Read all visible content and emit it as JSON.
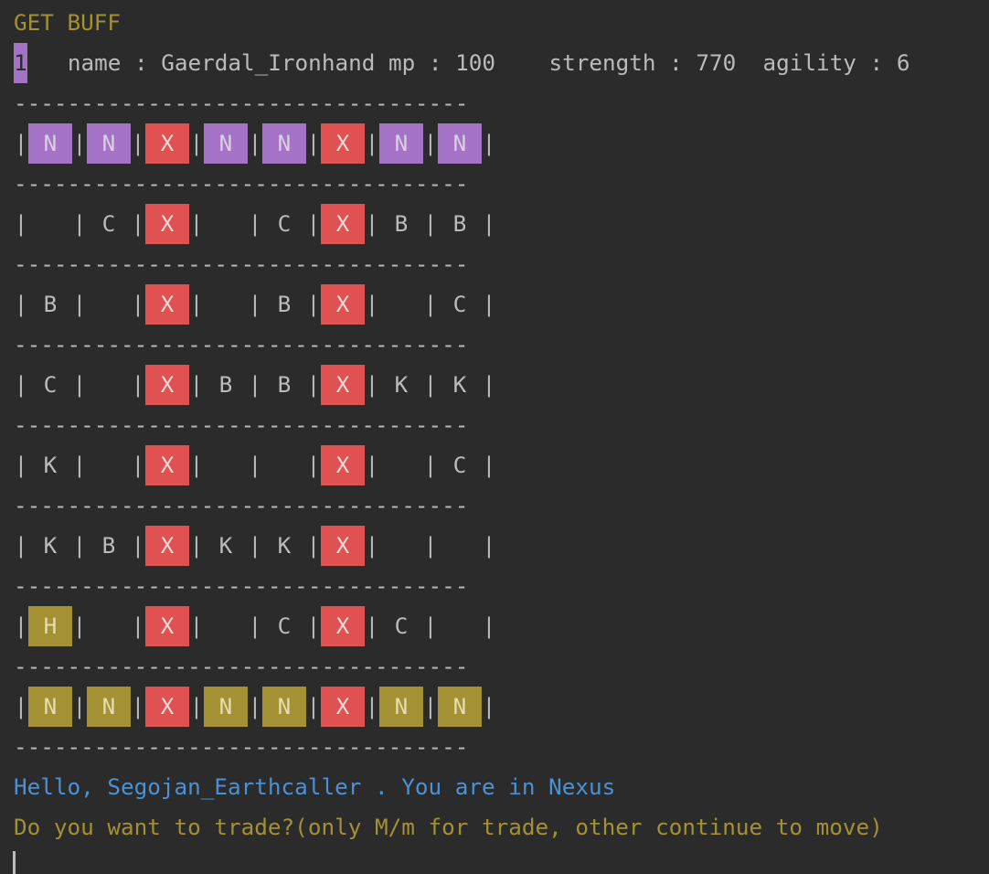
{
  "header": {
    "status": "GET BUFF",
    "index": "1",
    "info": "   name : Gaerdal_Ironhand mp : 100    strength : 770  agility : 6"
  },
  "separator": "----------------------------------",
  "board": {
    "rows": [
      [
        {
          "t": "N",
          "c": "purple"
        },
        {
          "t": "N",
          "c": "purple"
        },
        {
          "t": "X",
          "c": "red"
        },
        {
          "t": "N",
          "c": "purple"
        },
        {
          "t": "N",
          "c": "purple"
        },
        {
          "t": "X",
          "c": "red"
        },
        {
          "t": "N",
          "c": "purple"
        },
        {
          "t": "N",
          "c": "purple"
        }
      ],
      [
        {
          "t": "",
          "c": ""
        },
        {
          "t": "C",
          "c": ""
        },
        {
          "t": "X",
          "c": "red"
        },
        {
          "t": "",
          "c": ""
        },
        {
          "t": "C",
          "c": ""
        },
        {
          "t": "X",
          "c": "red"
        },
        {
          "t": "B",
          "c": ""
        },
        {
          "t": "B",
          "c": ""
        }
      ],
      [
        {
          "t": "B",
          "c": ""
        },
        {
          "t": "",
          "c": ""
        },
        {
          "t": "X",
          "c": "red"
        },
        {
          "t": "",
          "c": ""
        },
        {
          "t": "B",
          "c": ""
        },
        {
          "t": "X",
          "c": "red"
        },
        {
          "t": "",
          "c": ""
        },
        {
          "t": "C",
          "c": ""
        }
      ],
      [
        {
          "t": "C",
          "c": ""
        },
        {
          "t": "",
          "c": ""
        },
        {
          "t": "X",
          "c": "red"
        },
        {
          "t": "B",
          "c": ""
        },
        {
          "t": "B",
          "c": ""
        },
        {
          "t": "X",
          "c": "red"
        },
        {
          "t": "K",
          "c": ""
        },
        {
          "t": "K",
          "c": ""
        }
      ],
      [
        {
          "t": "K",
          "c": ""
        },
        {
          "t": "",
          "c": ""
        },
        {
          "t": "X",
          "c": "red"
        },
        {
          "t": "",
          "c": ""
        },
        {
          "t": "",
          "c": ""
        },
        {
          "t": "X",
          "c": "red"
        },
        {
          "t": "",
          "c": ""
        },
        {
          "t": "C",
          "c": ""
        }
      ],
      [
        {
          "t": "K",
          "c": ""
        },
        {
          "t": "B",
          "c": ""
        },
        {
          "t": "X",
          "c": "red"
        },
        {
          "t": "K",
          "c": ""
        },
        {
          "t": "K",
          "c": ""
        },
        {
          "t": "X",
          "c": "red"
        },
        {
          "t": "",
          "c": ""
        },
        {
          "t": "",
          "c": ""
        }
      ],
      [
        {
          "t": "H",
          "c": "gold"
        },
        {
          "t": "",
          "c": ""
        },
        {
          "t": "X",
          "c": "red"
        },
        {
          "t": "",
          "c": ""
        },
        {
          "t": "C",
          "c": ""
        },
        {
          "t": "X",
          "c": "red"
        },
        {
          "t": "C",
          "c": ""
        },
        {
          "t": "",
          "c": ""
        }
      ],
      [
        {
          "t": "N",
          "c": "gold"
        },
        {
          "t": "N",
          "c": "gold"
        },
        {
          "t": "X",
          "c": "red"
        },
        {
          "t": "N",
          "c": "gold"
        },
        {
          "t": "N",
          "c": "gold"
        },
        {
          "t": "X",
          "c": "red"
        },
        {
          "t": "N",
          "c": "gold"
        },
        {
          "t": "N",
          "c": "gold"
        }
      ]
    ],
    "cell_divider": "|"
  },
  "messages": {
    "greeting": "Hello, Segojan_Earthcaller . You are in Nexus",
    "prompt": "Do you want to trade?(only M/m for trade, other continue to move)"
  },
  "colors": {
    "background": "#2b2b2b",
    "text": "#bbbbbb",
    "yellow": "#a39133",
    "blue": "#4c91d4",
    "purple": "#a472c6",
    "red": "#e05252"
  }
}
